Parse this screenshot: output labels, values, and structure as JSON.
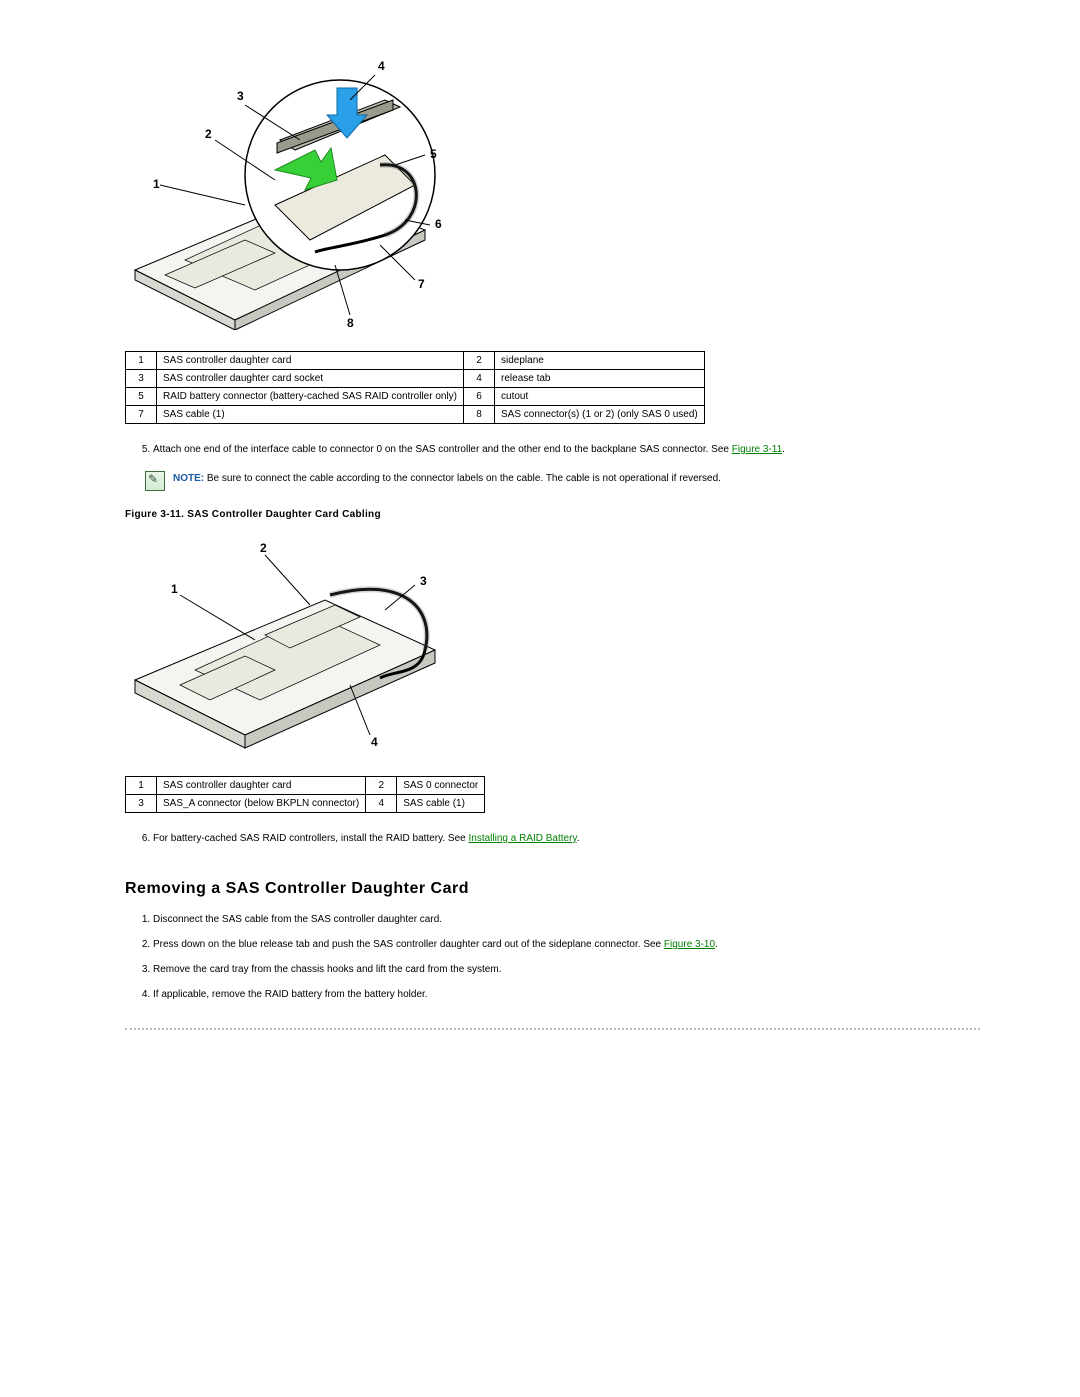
{
  "figure1": {
    "labels": [
      "1",
      "2",
      "3",
      "4",
      "5",
      "6",
      "7",
      "8"
    ],
    "table": [
      [
        "1",
        "SAS controller daughter card",
        "2",
        "sideplane"
      ],
      [
        "3",
        "SAS controller daughter card socket",
        "4",
        "release tab"
      ],
      [
        "5",
        "RAID battery connector (battery-cached SAS RAID controller only)",
        "6",
        "cutout"
      ],
      [
        "7",
        "SAS cable (1)",
        "8",
        "SAS connector(s) (1 or 2) (only SAS 0 used)"
      ]
    ]
  },
  "step5": {
    "num": "5.",
    "text_a": "Attach one end of the interface cable to connector 0 on the SAS controller and the other end to the backplane SAS connector. See ",
    "link": "Figure 3-11",
    "text_b": "."
  },
  "note": {
    "label": "NOTE:",
    "text": " Be sure to connect the cable according to the connector labels on the cable. The cable is not operational if reversed."
  },
  "figure2": {
    "caption": "Figure 3-11. SAS Controller Daughter Card Cabling",
    "labels": [
      "1",
      "2",
      "3",
      "4"
    ],
    "table": [
      [
        "1",
        "SAS controller daughter card",
        "2",
        "SAS 0 connector"
      ],
      [
        "3",
        "SAS_A connector (below BKPLN connector)",
        "4",
        "SAS cable (1)"
      ]
    ]
  },
  "step6": {
    "num": "6.",
    "text_a": "For battery-cached SAS RAID controllers, install the RAID battery. See ",
    "link": "Installing a RAID Battery",
    "text_b": "."
  },
  "section": {
    "title": "Removing a SAS Controller Daughter Card",
    "steps": [
      {
        "num": "1.",
        "text_a": "Disconnect the SAS cable from the SAS controller daughter card.",
        "link": "",
        "text_b": ""
      },
      {
        "num": "2.",
        "text_a": "Press down on the blue release tab and push the SAS controller daughter card out of the sideplane connector. See ",
        "link": "Figure 3-10",
        "text_b": "."
      },
      {
        "num": "3.",
        "text_a": "Remove the card tray from the chassis hooks and lift the card from the system.",
        "link": "",
        "text_b": ""
      },
      {
        "num": "4.",
        "text_a": "If applicable, remove the RAID battery from the battery holder.",
        "link": "",
        "text_b": ""
      }
    ]
  }
}
